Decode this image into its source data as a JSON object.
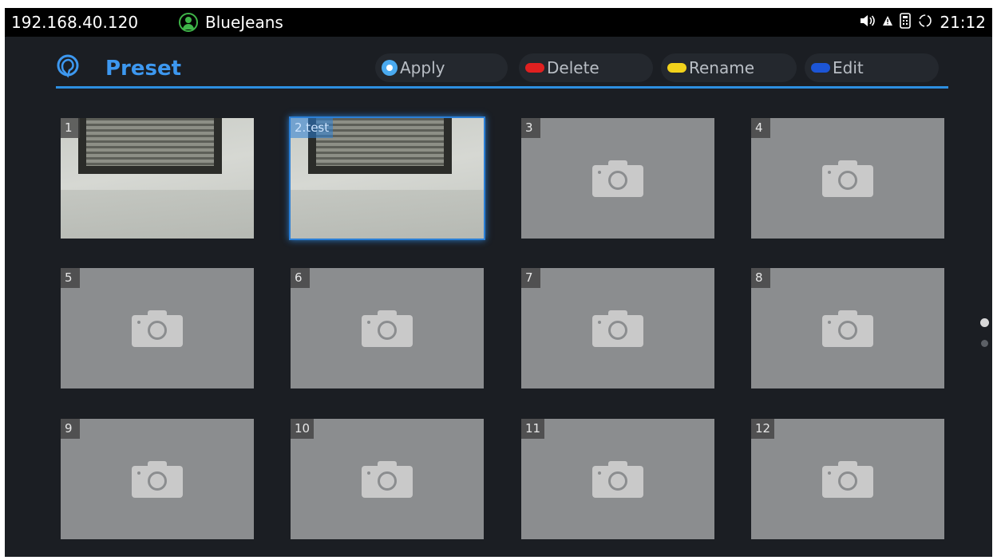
{
  "status_bar": {
    "ip": "192.168.40.120",
    "account_name": "BlueJeans",
    "time": "21:12",
    "icons": [
      "volume-icon",
      "warning-icon",
      "remote-icon",
      "sync-icon"
    ]
  },
  "header": {
    "title": "Preset",
    "buttons": [
      {
        "label": "Apply",
        "color": "#4aaaf0",
        "shape": "round"
      },
      {
        "label": "Delete",
        "color": "#e02020",
        "shape": "pill"
      },
      {
        "label": "Rename",
        "color": "#f2d21b",
        "shape": "pill"
      },
      {
        "label": "Edit",
        "color": "#1c55d6",
        "shape": "pill"
      }
    ]
  },
  "presets": [
    {
      "label": "1",
      "has_snapshot": true,
      "selected": false
    },
    {
      "label": "2.test",
      "has_snapshot": true,
      "selected": true
    },
    {
      "label": "3",
      "has_snapshot": false,
      "selected": false
    },
    {
      "label": "4",
      "has_snapshot": false,
      "selected": false
    },
    {
      "label": "5",
      "has_snapshot": false,
      "selected": false
    },
    {
      "label": "6",
      "has_snapshot": false,
      "selected": false
    },
    {
      "label": "7",
      "has_snapshot": false,
      "selected": false
    },
    {
      "label": "8",
      "has_snapshot": false,
      "selected": false
    },
    {
      "label": "9",
      "has_snapshot": false,
      "selected": false
    },
    {
      "label": "10",
      "has_snapshot": false,
      "selected": false
    },
    {
      "label": "11",
      "has_snapshot": false,
      "selected": false
    },
    {
      "label": "12",
      "has_snapshot": false,
      "selected": false
    }
  ],
  "pagination": {
    "page_count": 2,
    "current_page": 1
  },
  "colors": {
    "accent": "#3d98f0",
    "tile": "#8b8d8f",
    "background": "#1b1e23"
  }
}
